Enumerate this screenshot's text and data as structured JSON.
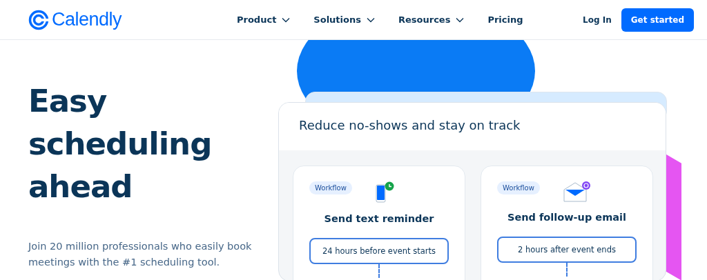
{
  "header": {
    "brand": "Calendly",
    "nav": [
      {
        "label": "Product",
        "dropdown": true
      },
      {
        "label": "Solutions",
        "dropdown": true
      },
      {
        "label": "Resources",
        "dropdown": true
      },
      {
        "label": "Pricing",
        "dropdown": false
      }
    ],
    "login": "Log In",
    "cta": "Get started"
  },
  "hero": {
    "heading": [
      "Easy",
      "scheduling",
      "ahead"
    ],
    "subtitle": "Join 20 million professionals who easily book meetings with the #1 scheduling tool."
  },
  "panel": {
    "title": "Reduce no-shows and stay on track",
    "cards": [
      {
        "tag": "Workflow",
        "kind": "sms",
        "title": "Send text reminder",
        "trigger": "24 hours before event starts"
      },
      {
        "tag": "Workflow",
        "kind": "email",
        "title": "Send follow-up email",
        "trigger": "2 hours after event ends"
      }
    ]
  }
}
